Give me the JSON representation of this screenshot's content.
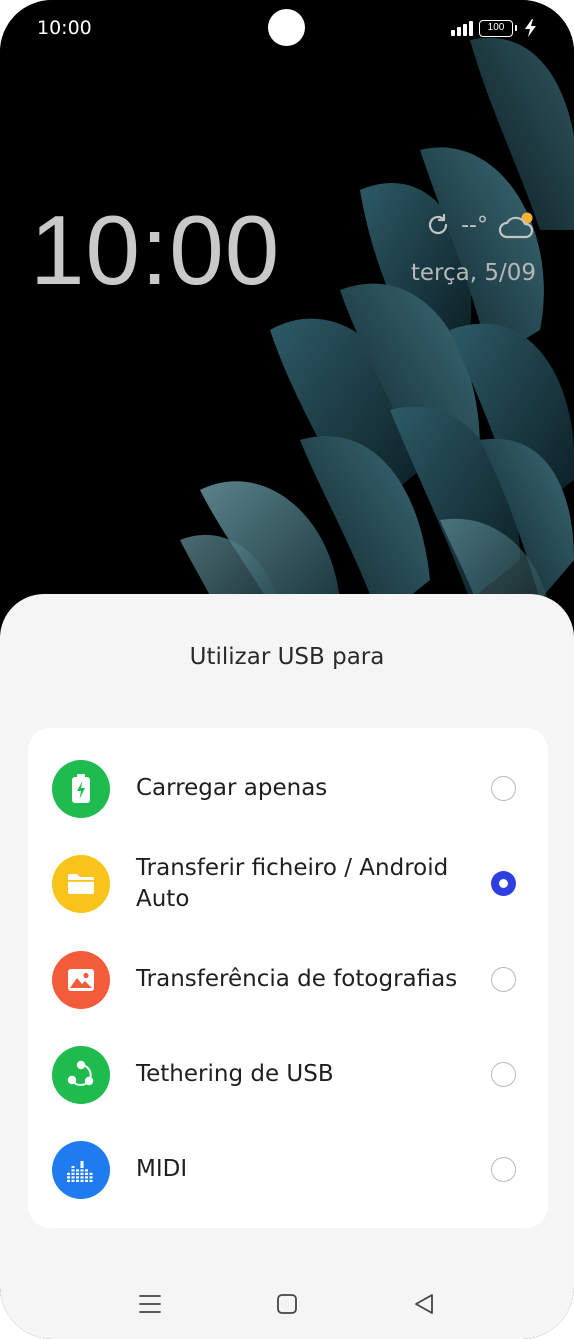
{
  "status_bar": {
    "time": "10:00",
    "battery_level": "100",
    "icons": [
      "signal-icon",
      "battery-icon",
      "charging-bolt-icon"
    ]
  },
  "lock_screen": {
    "clock": "10:00",
    "weather_temp": "--°",
    "date": "terça, 5/09",
    "icons": [
      "refresh-icon",
      "partly-cloudy-icon"
    ]
  },
  "usb_sheet": {
    "title": "Utilizar USB para",
    "options": [
      {
        "label": "Carregar apenas",
        "selected": false,
        "icon": "battery-charge-icon",
        "color": "#1fbb4f"
      },
      {
        "label": "Transferir ficheiro / Android Auto",
        "selected": true,
        "icon": "folder-icon",
        "color": "#f8c41c"
      },
      {
        "label": "Transferência de fotografias",
        "selected": false,
        "icon": "photo-icon",
        "color": "#f25c3a"
      },
      {
        "label": "Tethering de USB",
        "selected": false,
        "icon": "share-icon",
        "color": "#1fbb4f"
      },
      {
        "label": "MIDI",
        "selected": false,
        "icon": "equalizer-icon",
        "color": "#1f7cf0"
      }
    ],
    "accent_color": "#2f3ee0"
  },
  "nav_bar": {
    "buttons": [
      "menu-icon",
      "home-icon",
      "back-icon"
    ]
  }
}
